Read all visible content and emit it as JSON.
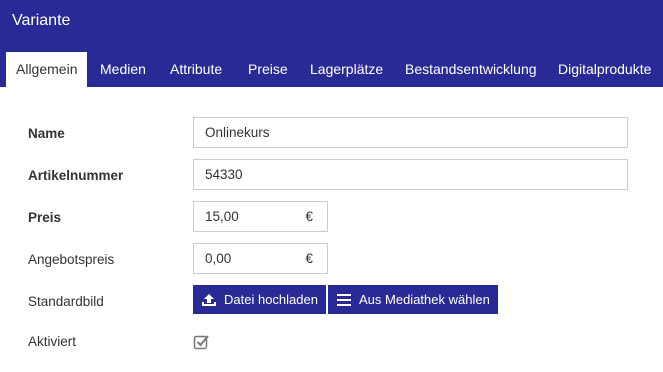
{
  "header": {
    "title": "Variante"
  },
  "tabs": [
    {
      "label": "Allgemein",
      "active": true
    },
    {
      "label": "Medien"
    },
    {
      "label": "Attribute"
    },
    {
      "label": "Preise"
    },
    {
      "label": "Lagerplätze"
    },
    {
      "label": "Bestandsentwicklung"
    },
    {
      "label": "Digitalprodukte"
    }
  ],
  "form": {
    "name": {
      "label": "Name",
      "value": "Onlinekurs"
    },
    "sku": {
      "label": "Artikelnummer",
      "value": "54330"
    },
    "price": {
      "label": "Preis",
      "value": "15,00",
      "unit": "€"
    },
    "offer_price": {
      "label": "Angebotspreis",
      "value": "0,00",
      "unit": "€"
    },
    "default_image": {
      "label": "Standardbild",
      "upload_label": "Datei hochladen",
      "library_label": "Aus Mediathek wählen"
    },
    "activated": {
      "label": "Aktiviert",
      "checked": true
    }
  },
  "colors": {
    "brand": "#2a2a96",
    "border": "#cccccc"
  },
  "icons": {
    "upload": "upload-icon",
    "library": "list-icon",
    "checkbox": "checkbox-checked-icon"
  }
}
